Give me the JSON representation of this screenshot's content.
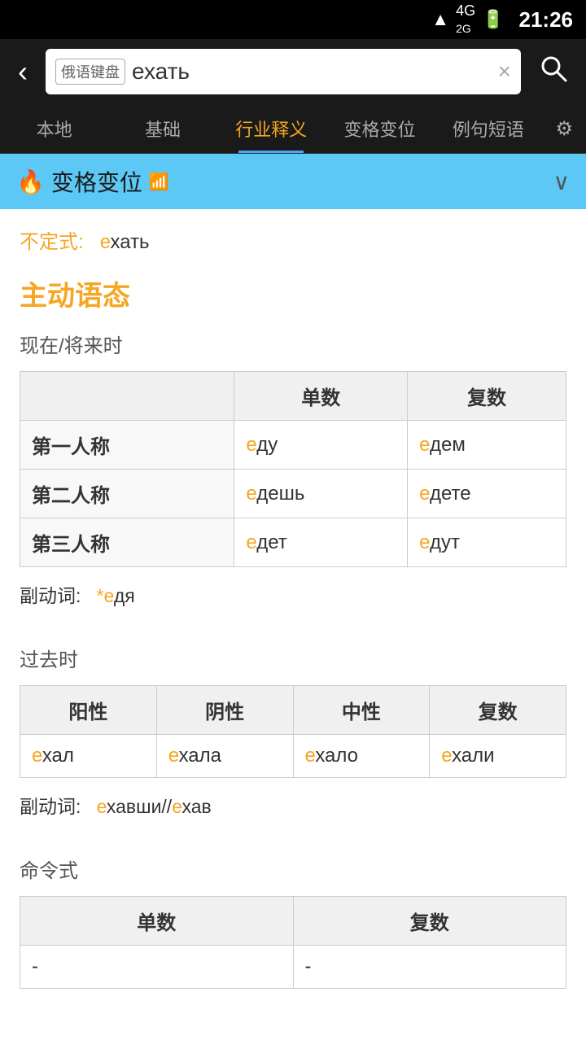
{
  "statusBar": {
    "time": "21:26",
    "icons": "wifi 4G battery"
  },
  "topBar": {
    "backLabel": "‹",
    "keyboardTag": "俄语键盘",
    "searchValue": "ехать",
    "clearLabel": "×",
    "searchIconLabel": "🔍"
  },
  "tabs": [
    {
      "id": "local",
      "label": "本地",
      "active": false
    },
    {
      "id": "basic",
      "label": "基础",
      "active": false
    },
    {
      "id": "industry",
      "label": "行业释义",
      "active": true
    },
    {
      "id": "conjugation",
      "label": "变格变位",
      "active": false
    },
    {
      "id": "examples",
      "label": "例句短语",
      "active": false
    }
  ],
  "settingsIcon": "⚙",
  "sectionHeader": {
    "icon": "🔥",
    "title": "变格变位",
    "wifiIcon": "📶",
    "chevron": "❯"
  },
  "infinitive": {
    "label": "不定式:",
    "prefix": "е",
    "rest": "хать"
  },
  "activeVoice": {
    "title": "主动语态"
  },
  "presentFuture": {
    "label": "现在/将来时",
    "headers": [
      "",
      "单数",
      "复数"
    ],
    "rows": [
      {
        "person": "第一人称",
        "singular_prefix": "е",
        "singular_rest": "ду",
        "plural_prefix": "е",
        "plural_rest": "дем"
      },
      {
        "person": "第二人称",
        "singular_prefix": "е",
        "singular_rest": "дешь",
        "plural_prefix": "е",
        "plural_rest": "дете"
      },
      {
        "person": "第三人称",
        "singular_prefix": "е",
        "singular_rest": "дет",
        "plural_prefix": "е",
        "plural_rest": "дут"
      }
    ],
    "adverb_label": "副动词:",
    "adverb_prefix": "*е",
    "adverb_rest": "дя"
  },
  "past": {
    "label": "过去时",
    "headers": [
      "阳性",
      "阴性",
      "中性",
      "复数"
    ],
    "row": [
      {
        "prefix": "е",
        "rest": "хал"
      },
      {
        "prefix": "е",
        "rest": "хала"
      },
      {
        "prefix": "е",
        "rest": "хало"
      },
      {
        "prefix": "е",
        "rest": "хали"
      }
    ],
    "adverb_label": "副动词:",
    "adverb_text1_prefix": "е",
    "adverb_text1_rest": "хавши//",
    "adverb_text2_prefix": "е",
    "adverb_text2_rest": "хав"
  },
  "imperative": {
    "label": "命令式",
    "headers": [
      "单数",
      "复数"
    ],
    "rows": [
      {
        "singular": "-",
        "plural": "-"
      }
    ]
  }
}
